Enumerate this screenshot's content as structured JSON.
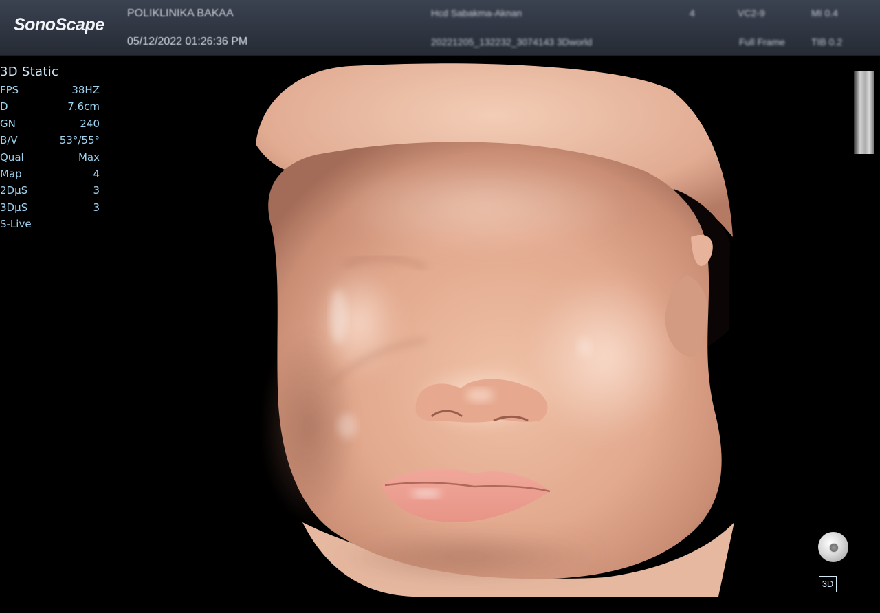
{
  "header": {
    "brand": "SonoScape",
    "patient_name": "POLIKLINIKA BAKAA",
    "datetime": "05/12/2022 01:26:36 PM",
    "center_line1": "Hcd Sabakma-Aknan",
    "center_line2": "20221205_132232_3074143 3Dworld",
    "probe_mark": "4",
    "probe_line1": "VC2-9",
    "probe_line2": "Full Frame",
    "index_line1": "MI 0.4",
    "index_line2": "TIB 0.2"
  },
  "mode_title": "3D Static",
  "parameters": [
    {
      "label": "FPS",
      "value": "38HZ"
    },
    {
      "label": "D",
      "value": "7.6cm"
    },
    {
      "label": "GN",
      "value": "240"
    },
    {
      "label": "B/V",
      "value": "53°/55°"
    },
    {
      "label": "Qual",
      "value": "Max"
    },
    {
      "label": "Map",
      "value": "4"
    },
    {
      "label": "2DμS",
      "value": "3"
    },
    {
      "label": "3DμS",
      "value": "3"
    },
    {
      "label": "S-Live",
      "value": ""
    }
  ],
  "mode_badge": "3D",
  "icons": {
    "trackball": "trackball-icon",
    "grayscale": "grayscale-bar"
  },
  "colors": {
    "header_bg": "#2e3440",
    "param_text": "#9fd3f0",
    "skin": "#e9b49a"
  }
}
